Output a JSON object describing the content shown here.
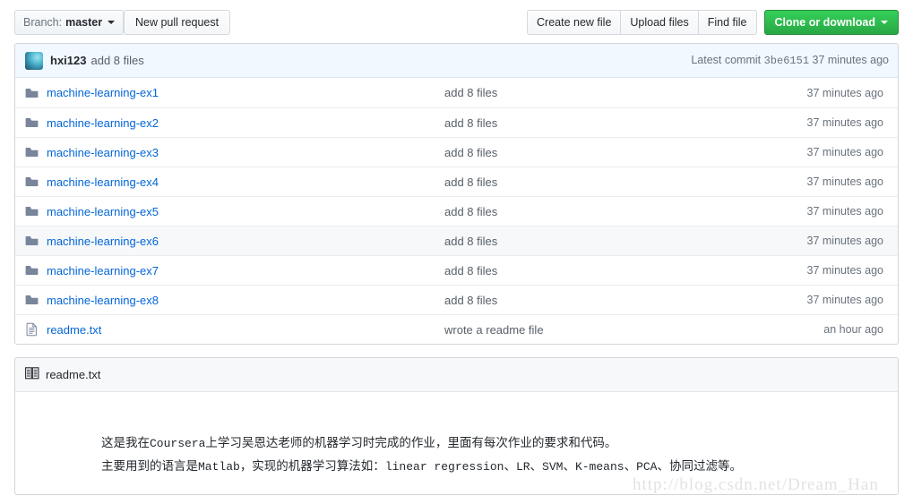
{
  "toolbar": {
    "branch_label": "Branch:",
    "branch_name": "master",
    "new_pull_request": "New pull request",
    "create_new_file": "Create new file",
    "upload_files": "Upload files",
    "find_file": "Find file",
    "clone_or_download": "Clone or download"
  },
  "commit_header": {
    "author": "hxi123",
    "message": "add 8 files",
    "latest_commit_label": "Latest commit",
    "sha": "3be6151",
    "age": "37 minutes ago"
  },
  "files": [
    {
      "icon": "folder-icon",
      "name": "machine-learning-ex1",
      "message": "add 8 files",
      "age": "37 minutes ago",
      "hovered": false
    },
    {
      "icon": "folder-icon",
      "name": "machine-learning-ex2",
      "message": "add 8 files",
      "age": "37 minutes ago",
      "hovered": false
    },
    {
      "icon": "folder-icon",
      "name": "machine-learning-ex3",
      "message": "add 8 files",
      "age": "37 minutes ago",
      "hovered": false
    },
    {
      "icon": "folder-icon",
      "name": "machine-learning-ex4",
      "message": "add 8 files",
      "age": "37 minutes ago",
      "hovered": false
    },
    {
      "icon": "folder-icon",
      "name": "machine-learning-ex5",
      "message": "add 8 files",
      "age": "37 minutes ago",
      "hovered": false
    },
    {
      "icon": "folder-icon",
      "name": "machine-learning-ex6",
      "message": "add 8 files",
      "age": "37 minutes ago",
      "hovered": true
    },
    {
      "icon": "folder-icon",
      "name": "machine-learning-ex7",
      "message": "add 8 files",
      "age": "37 minutes ago",
      "hovered": false
    },
    {
      "icon": "folder-icon",
      "name": "machine-learning-ex8",
      "message": "add 8 files",
      "age": "37 minutes ago",
      "hovered": false
    },
    {
      "icon": "file-icon",
      "name": "readme.txt",
      "message": "wrote a readme file",
      "age": "an hour ago",
      "hovered": false
    }
  ],
  "readme": {
    "title": "readme.txt",
    "line1_a": "这是我在",
    "line1_mono1": "Coursera",
    "line1_b": "上学习吴恩达老师的机器学习时完成的作业，里面有每次作业的要求和代码。",
    "line2_a": "主要用到的语言是",
    "line2_mono1": "Matlab",
    "line2_b": "，实现的机器学习算法如：",
    "line2_mono2": "linear regression",
    "line2_c": "、",
    "line2_mono3": "LR",
    "line2_d": "、",
    "line2_mono4": "SVM",
    "line2_e": "、",
    "line2_mono5": "K-means",
    "line2_f": "、",
    "line2_mono6": "PCA",
    "line2_g": "、协同过滤等。"
  },
  "watermark": "http://blog.csdn.net/Dream_Han",
  "colors": {
    "link": "#0366d6",
    "clone_green": "#28a745",
    "commit_header_bg": "#f1f8ff",
    "hover_row_bg": "#f6f8fa",
    "border": "#d1d5da"
  }
}
